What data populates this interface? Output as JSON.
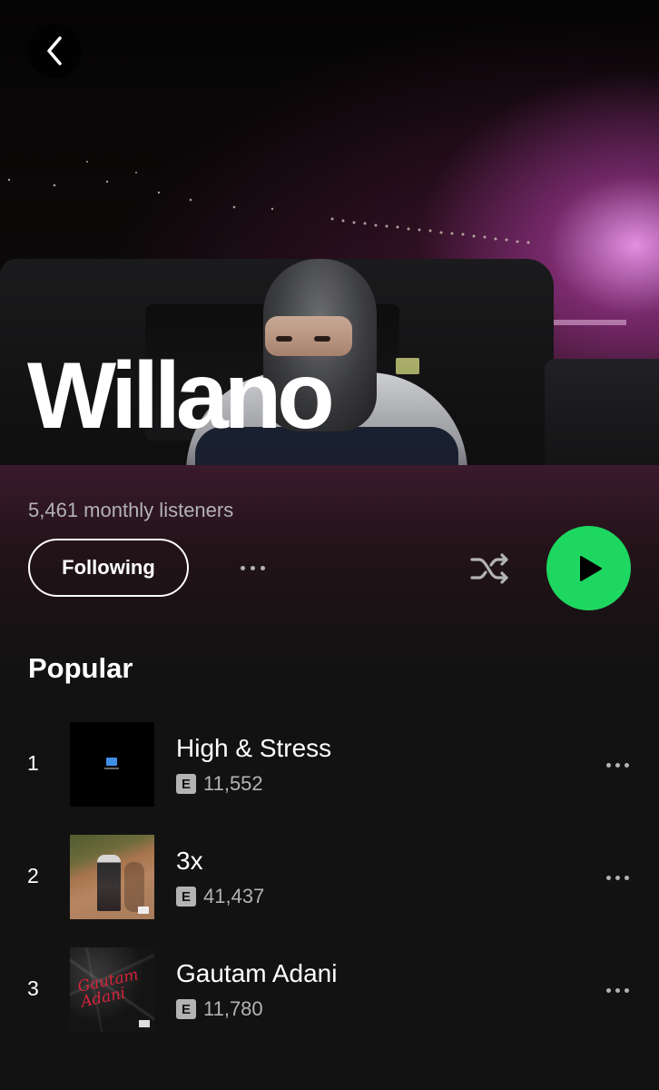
{
  "artist": {
    "name": "Willano",
    "monthly_listeners": "5,461 monthly listeners"
  },
  "actions": {
    "follow_label": "Following"
  },
  "popular": {
    "title": "Popular",
    "tracks": [
      {
        "rank": "1",
        "title": "High & Stress",
        "explicit": "E",
        "plays": "11,552"
      },
      {
        "rank": "2",
        "title": "3x",
        "explicit": "E",
        "plays": "41,437"
      },
      {
        "rank": "3",
        "title": "Gautam Adani",
        "explicit": "E",
        "plays": "11,780"
      }
    ]
  },
  "colors": {
    "accent": "#1ed760",
    "background": "#121212",
    "secondary_text": "#b3b3b3"
  },
  "icons": {
    "back": "chevron-left-icon",
    "more": "more-horizontal-icon",
    "shuffle": "shuffle-icon",
    "play": "play-icon",
    "explicit": "explicit-badge"
  }
}
